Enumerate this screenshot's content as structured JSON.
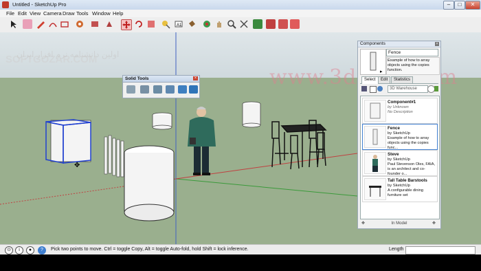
{
  "window": {
    "title": "Untitled - SketchUp Pro",
    "controls": [
      "–",
      "□",
      "✕"
    ]
  },
  "menu": [
    "File",
    "Edit",
    "View",
    "Camera",
    "Draw",
    "Tools",
    "Window",
    "Help"
  ],
  "watermarks": {
    "logo": "SOFTGOZAR.COM",
    "persian": "اولین دانشنامه نرم افزار ایران",
    "english": "www.3dshut.com"
  },
  "solid_tools": {
    "title": "Solid Tools"
  },
  "components": {
    "title": "Components",
    "selected_name": "Fence",
    "selected_desc": "Example of how to array objects using the copies function.",
    "tabs": [
      "Select",
      "Edit",
      "Statistics"
    ],
    "search_placeholder": "3D Warehouse",
    "items": [
      {
        "name": "Component#1",
        "by": "by Unknown",
        "desc": "No Description"
      },
      {
        "name": "Fence",
        "by": "by SketchUp",
        "desc": "Example of how to array objects using the copies func..."
      },
      {
        "name": "Steve",
        "by": "by SketchUp",
        "desc": "Paul Stevenson Oles, FAIA, is an architect and co-founder o..."
      },
      {
        "name": "Tall Table Barstools",
        "by": "by SketchUp",
        "desc": "A configurable dining furniture set"
      }
    ],
    "footer": "In Model"
  },
  "status": {
    "hint": "Pick two points to move.  Ctrl = toggle Copy, Alt = toggle Auto-fold, hold Shift = lock inference.",
    "measurement_label": "Length",
    "measurement_value": ""
  }
}
